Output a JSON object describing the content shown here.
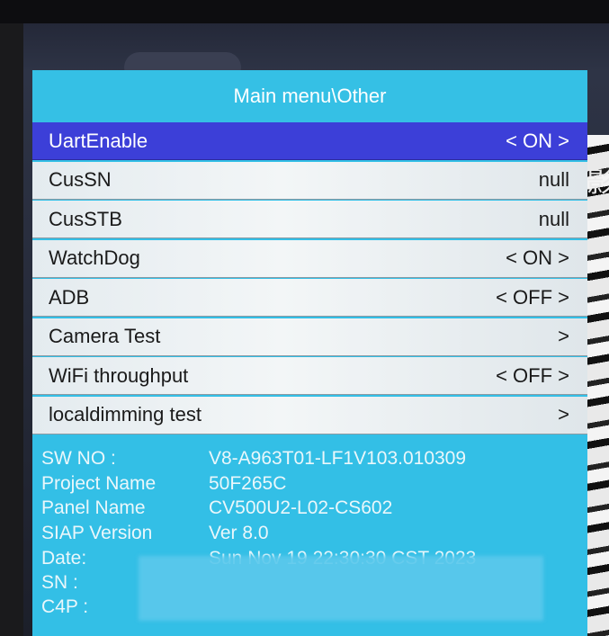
{
  "menu": {
    "title": "Main menu\\Other",
    "items": [
      {
        "label": "UartEnable",
        "value": "< ON >",
        "selected": true
      },
      {
        "label": "CusSN",
        "value": "null",
        "selected": false
      },
      {
        "label": "CusSTB",
        "value": "null",
        "selected": false
      },
      {
        "label": "WatchDog",
        "value": "< ON >",
        "selected": false
      },
      {
        "label": "ADB",
        "value": "< OFF >",
        "selected": false
      },
      {
        "label": "Camera Test",
        "value": ">",
        "selected": false
      },
      {
        "label": "WiFi throughput",
        "value": "< OFF >",
        "selected": false
      },
      {
        "label": "localdimming test",
        "value": ">",
        "selected": false
      }
    ]
  },
  "info": {
    "sw_no": {
      "label": "SW NO :",
      "value": "V8-A963T01-LF1V103.010309"
    },
    "project_name": {
      "label": "Project Name",
      "value": "50F265C"
    },
    "panel_name": {
      "label": "Panel Name",
      "value": "CV500U2-L02-CS602"
    },
    "siap_version": {
      "label": "SIAP Version",
      "value": "Ver 8.0"
    },
    "date": {
      "label": "Date:",
      "value": "Sun Nov 19 22:30:30 CST 2023"
    },
    "sn": {
      "label": "SN :",
      "value": ""
    },
    "c4p": {
      "label": "C4P :",
      "value": ""
    }
  },
  "background": {
    "glyph": "影"
  },
  "colors": {
    "panel": "#33bfe6",
    "selected_row": "#3c3fd8",
    "row": "#eef2f4"
  }
}
